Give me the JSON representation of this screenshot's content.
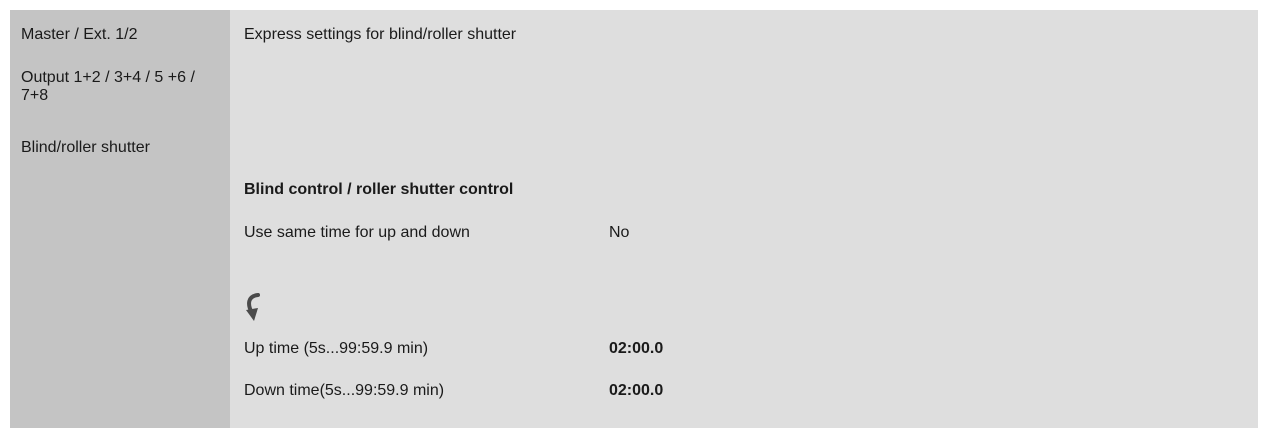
{
  "sidebar": {
    "items": [
      {
        "label": "Master / Ext. 1/2"
      },
      {
        "label": "Output 1+2 / 3+4 / 5 +6 / 7+8"
      },
      {
        "label": "Blind/roller shutter"
      }
    ]
  },
  "main": {
    "title": "Express settings for blind/roller shutter",
    "section_heading": "Blind control / roller shutter control",
    "rows": [
      {
        "label": "Use same time for up and down",
        "value": "No"
      },
      {
        "label": "Up time (5s...99:59.9 min)",
        "value": "02:00.0"
      },
      {
        "label": "Down time(5s...99:59.9 min)",
        "value": "02:00.0"
      }
    ],
    "icon": "curved-arrow-down-icon"
  },
  "colors": {
    "sidebar_bg": "#c4c4c4",
    "main_bg": "#dedede",
    "icon": "#4a4a4a"
  }
}
